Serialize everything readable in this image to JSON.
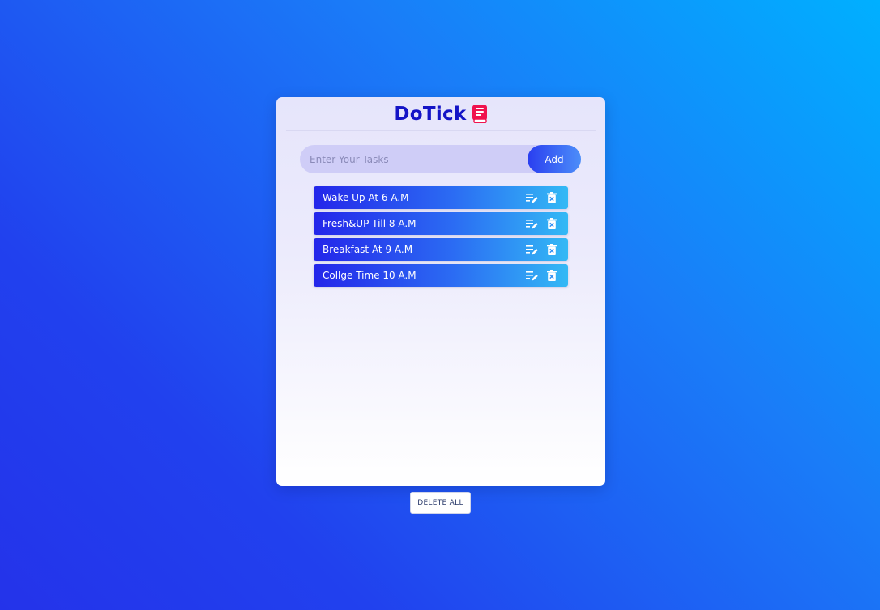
{
  "app": {
    "title": "DoTick",
    "icon": "book-icon"
  },
  "input": {
    "placeholder": "Enter Your Tasks",
    "value": ""
  },
  "add_button": {
    "label": "Add"
  },
  "tasks": [
    {
      "text": "Wake Up At 6 A.M",
      "edit_icon": "edit-icon",
      "delete_icon": "trash-icon"
    },
    {
      "text": "Fresh&UP Till 8 A.M",
      "edit_icon": "edit-icon",
      "delete_icon": "trash-icon"
    },
    {
      "text": "Breakfast At 9 A.M",
      "edit_icon": "edit-icon",
      "delete_icon": "trash-icon"
    },
    {
      "text": "Collge Time 10 A.M",
      "edit_icon": "edit-icon",
      "delete_icon": "trash-icon"
    }
  ],
  "delete_all": {
    "label": "DELETE ALL"
  },
  "colors": {
    "title": "#1414c6",
    "book_icon": "#f0124e",
    "task_gradient_start": "#2426ea",
    "task_gradient_end": "#33b9f5"
  }
}
